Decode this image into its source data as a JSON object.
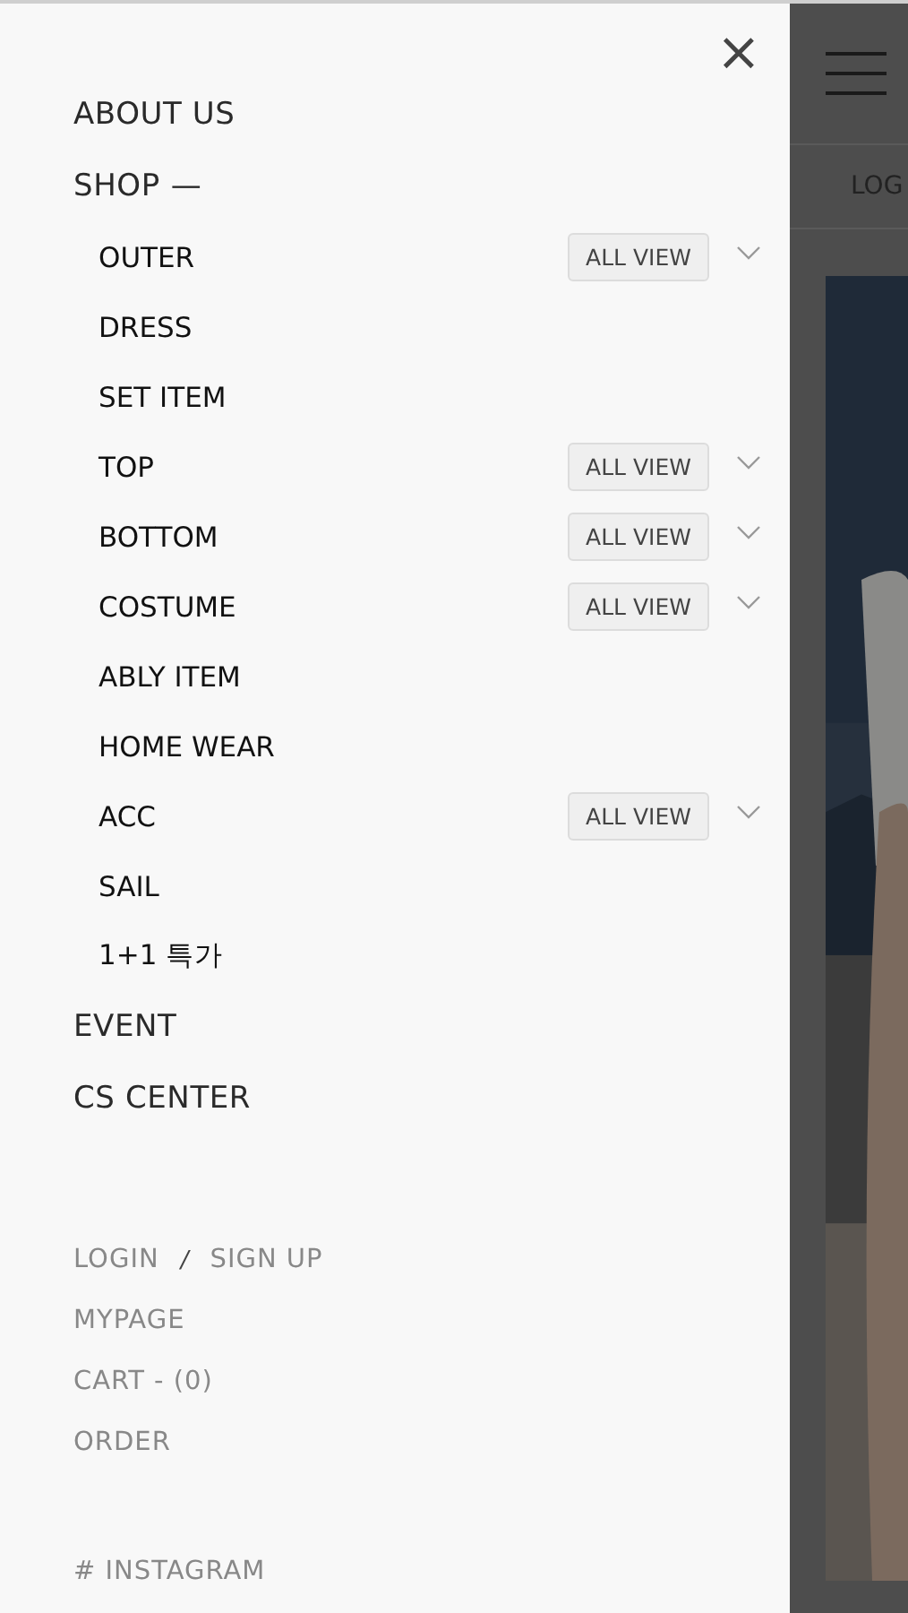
{
  "drawer": {
    "close": "×",
    "menu": [
      {
        "label": "ABOUT US"
      },
      {
        "label": "SHOP",
        "toggle": "—",
        "children": [
          {
            "label": "OUTER",
            "all_view": "ALL VIEW"
          },
          {
            "label": "DRESS"
          },
          {
            "label": "SET ITEM"
          },
          {
            "label": "TOP",
            "all_view": "ALL VIEW"
          },
          {
            "label": "BOTTOM",
            "all_view": "ALL VIEW"
          },
          {
            "label": "COSTUME",
            "all_view": "ALL VIEW"
          },
          {
            "label": "ABLY ITEM"
          },
          {
            "label": "HOME WEAR"
          },
          {
            "label": "ACC",
            "all_view": "ALL VIEW"
          },
          {
            "label": "SAIL"
          },
          {
            "label": "1+1 특가"
          }
        ]
      },
      {
        "label": "EVENT"
      },
      {
        "label": "CS CENTER"
      }
    ],
    "account": {
      "login": "LOGIN",
      "separator": "/",
      "signup": "SIGN UP",
      "links": [
        "MYPAGE",
        "CART - (0)",
        "ORDER"
      ]
    },
    "instagram": "# INSTAGRAM"
  },
  "background_page": {
    "nav_text": "LOG"
  }
}
